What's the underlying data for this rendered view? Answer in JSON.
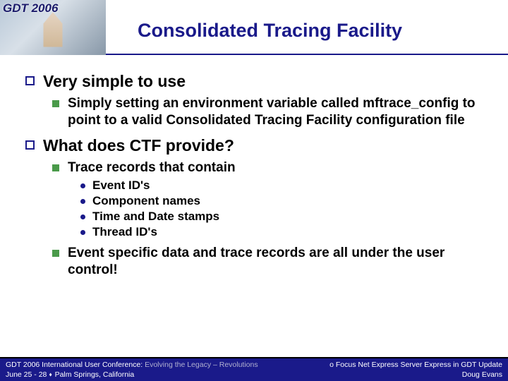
{
  "header": {
    "logo_text": "GDT 2006",
    "title": "Consolidated Tracing Facility"
  },
  "bullets": {
    "b1": "Very simple to use",
    "b1_1": "Simply setting an environment variable called mftrace_config to point to a valid Consolidated Tracing Facility configuration file",
    "b2": "What does CTF provide?",
    "b2_1": "Trace records that contain",
    "b2_1_a": "Event ID's",
    "b2_1_b": "Component names",
    "b2_1_c": "Time and Date stamps",
    "b2_1_d": "Thread ID's",
    "b2_2": "Event specific data and trace records are all under the user control!"
  },
  "footer": {
    "left_line1_a": "GDT 2006 International User Conference: ",
    "left_line1_b": "Evolving the Legacy – Revolutions",
    "left_line2_a": "June 25 - 28",
    "left_line2_b": "Palm Springs, California",
    "right_line1": "o Focus Net Express Server Express in GDT Update",
    "right_line2": "Doug Evans"
  }
}
